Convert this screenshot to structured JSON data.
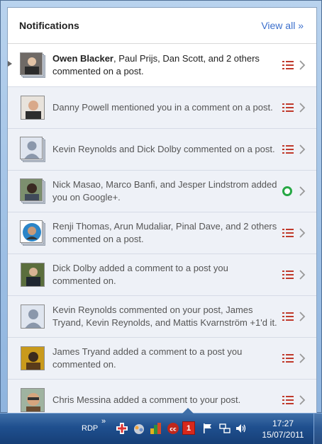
{
  "header": {
    "title": "Notifications",
    "view_all": "View all »"
  },
  "notifications": [
    {
      "bold": "Owen Blacker",
      "rest": ", Paul Prijs, Dan Scott, and 2 others commented on a post.",
      "icon": "list",
      "unread": true
    },
    {
      "bold": "",
      "rest": "Danny Powell mentioned you in a comment on a post.",
      "icon": "list",
      "unread": false
    },
    {
      "bold": "",
      "rest": "Kevin Reynolds and Dick Dolby commented on a post.",
      "icon": "list",
      "unread": false
    },
    {
      "bold": "",
      "rest": "Nick Masao, Marco Banfi, and Jesper Lindstrom added you on Google+.",
      "icon": "circle",
      "unread": false
    },
    {
      "bold": "",
      "rest": "Renji Thomas, Arun Mudaliar, Pinal Dave, and 2 others commented on a post.",
      "icon": "list",
      "unread": false
    },
    {
      "bold": "",
      "rest": "Dick Dolby added a comment to a post you commented on.",
      "icon": "list",
      "unread": false
    },
    {
      "bold": "",
      "rest": "Kevin Reynolds commented on your post, James Tryand, Kevin Reynolds, and Mattis Kvarnström +1'd it.",
      "icon": "list",
      "unread": false
    },
    {
      "bold": "",
      "rest": "James Tryand added a comment to a post you commented on.",
      "icon": "list",
      "unread": false
    },
    {
      "bold": "",
      "rest": "Chris Messina added a comment to your post.",
      "icon": "list",
      "unread": false
    }
  ],
  "taskbar": {
    "rdp": "RDP",
    "more": "»",
    "badge_count": "1",
    "time": "17:27",
    "date": "15/07/2011"
  },
  "colors": {
    "accent": "#3b6fcc",
    "badge": "#d8281c",
    "list_icon": "#c0392b",
    "circle_icon": "#27a845"
  }
}
